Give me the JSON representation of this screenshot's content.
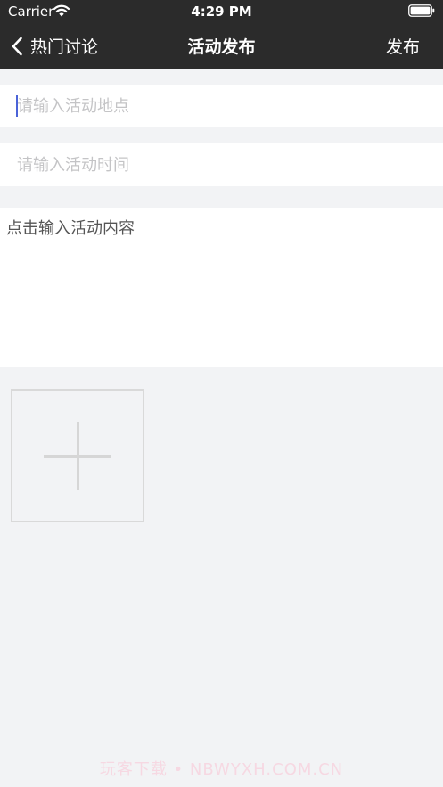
{
  "status_bar": {
    "carrier": "Carrier",
    "time": "4:29 PM"
  },
  "nav": {
    "back_label": "热门讨论",
    "title": "活动发布",
    "publish_label": "发布"
  },
  "form": {
    "location_placeholder": "请输入活动地点",
    "time_placeholder": "请输入活动时间",
    "content_placeholder": "点击输入活动内容"
  },
  "watermark": "玩客下载 • NBWYXH.COM.CN",
  "colors": {
    "nav_background": "#2b2b2b",
    "page_background": "#f2f3f5",
    "caret": "#4b63d8"
  },
  "icons": {
    "back": "chevron-left-icon",
    "add_photo": "plus-icon",
    "wifi": "wifi-icon",
    "battery": "battery-icon"
  }
}
